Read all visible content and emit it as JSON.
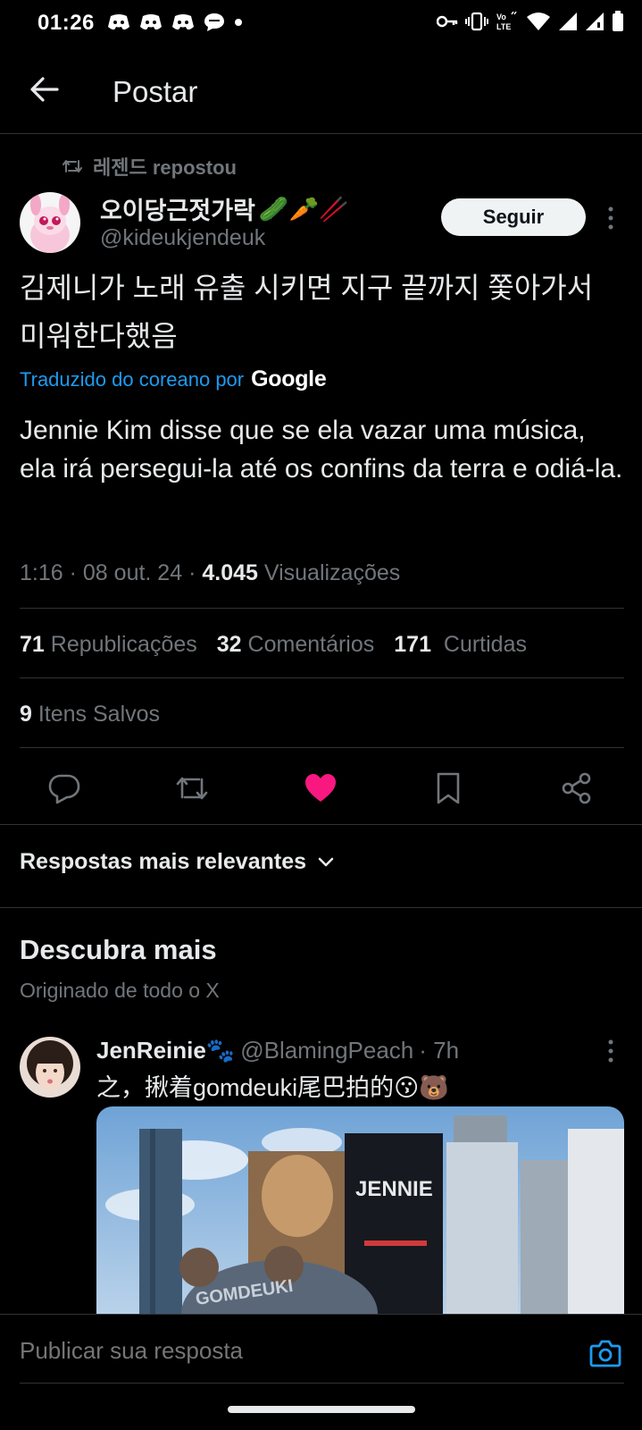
{
  "status_bar": {
    "time": "01:26",
    "left_icons": [
      "discord-icon",
      "discord-icon",
      "discord-icon",
      "chat-bubble-icon",
      "dot-icon"
    ],
    "right_icons": [
      "key-icon",
      "vibrate-icon",
      "volte-icon",
      "wifi-icon",
      "signal-icon",
      "signal-icon",
      "battery-icon"
    ],
    "volte_label": "Vo LTE"
  },
  "header": {
    "title": "Postar"
  },
  "post": {
    "repost_by": "레젠드 repostou",
    "author_name": "오이당근젓가락",
    "author_emojis": "🥒🥕🥢",
    "author_handle": "@kideukjendeuk",
    "follow_label": "Seguir",
    "text": "김제니가 노래 유출 시키면 지구 끝까지 쫓아가서 미워한다했음",
    "translated_label": "Traduzido do coreano por",
    "translator_brand": "Google",
    "translation": "Jennie Kim disse que se ela vazar uma música, ela irá persegui-la até os confins da terra e odiá-la.",
    "time": "1:16",
    "date": "08 out. 24",
    "views_count": "4.045",
    "views_label": "Visualizações",
    "reposts_count": "71",
    "reposts_label": "Republicações",
    "comments_count": "32",
    "comments_label": "Comentários",
    "likes_count": "171",
    "likes_label": "Curtidas",
    "saved_count": "9",
    "saved_label": "Itens Salvos",
    "liked": true
  },
  "replies": {
    "sort_label": "Respostas mais relevantes"
  },
  "discover": {
    "title": "Descubra mais",
    "subtitle": "Originado de todo o X",
    "post": {
      "author_name": "JenReinie🐾",
      "author_handle": "@BlamingPeach",
      "age": "· 7h",
      "text": "之，揪着gomdeuki尾巴拍的😗🐻"
    }
  },
  "reply_box": {
    "placeholder": "Publicar sua resposta"
  },
  "colors": {
    "background": "#000000",
    "text": "#e7e9ea",
    "muted": "#71767b",
    "accent": "#1d9bf0",
    "like": "#f91880",
    "divider": "#2f3336"
  }
}
